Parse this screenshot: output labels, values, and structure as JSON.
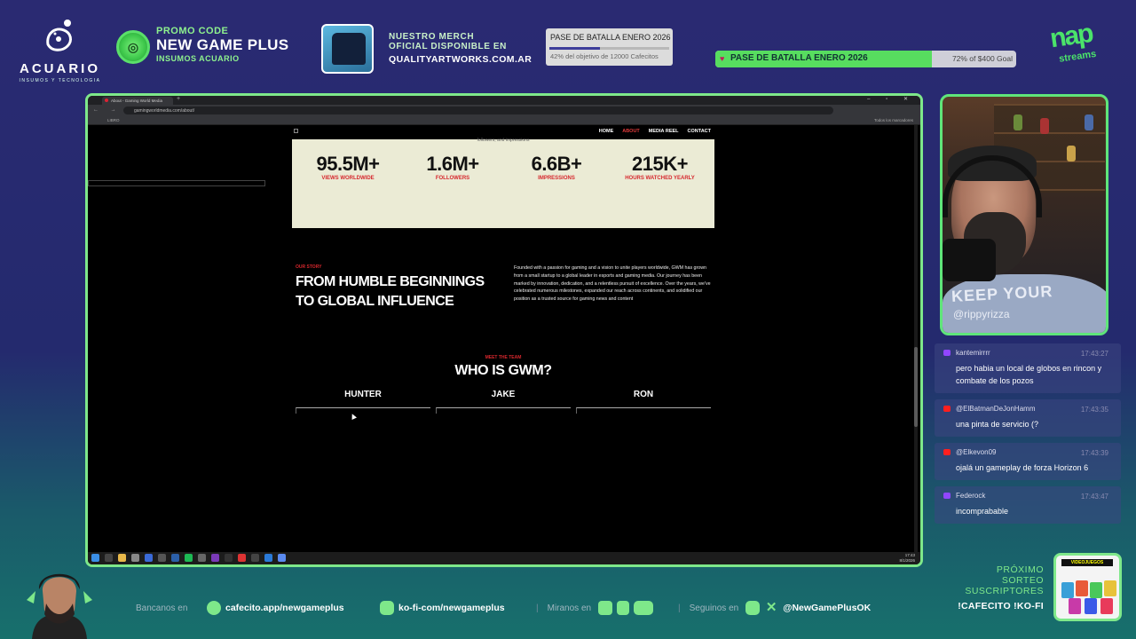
{
  "overlay": {
    "sponsor": {
      "name": "ACUARIO",
      "tagline": "INSUMOS Y TECNOLOGIA"
    },
    "promo": {
      "line1": "PROMO CODE",
      "code": "NEW GAME PLUS",
      "line3": "INSUMOS ACUARIO"
    },
    "merch": {
      "line1": "NUESTRO MERCH",
      "line2": "OFICIAL DISPONIBLE EN",
      "url": "QUALITYARTWORKS.COM.AR"
    },
    "goal_small": {
      "title": "PASE DE BATALLA ENERO 2026",
      "progress": 0.42,
      "status": "42% del objetivo de 12000 Cafecitos"
    },
    "goal_bar": {
      "title": "PASE DE BATALLA ENERO 2026",
      "progress": 0.72,
      "amount": "72% of $400 Goal"
    },
    "channel_logo": {
      "name": "nap",
      "sub": "streams"
    }
  },
  "browser": {
    "tab_title": "About - Gaming World Media",
    "url": "gamingworldmedia.com/about/",
    "bookmark_left": "LIBRO",
    "bookmark_right": "Todos los marcadores",
    "site": {
      "nav": [
        "HOME",
        "ABOUT",
        "MEDIA REEL",
        "CONTACT"
      ],
      "stats_caption": "followers, and impressions",
      "stats": [
        {
          "value": "95.5M+",
          "label": "VIEWS WORLDWIDE"
        },
        {
          "value": "1.6M+",
          "label": "FOLLOWERS"
        },
        {
          "value": "6.6B+",
          "label": "IMPRESSIONS"
        },
        {
          "value": "215K+",
          "label": "HOURS WATCHED YEARLY"
        }
      ],
      "story": {
        "eyebrow": "OUR STORY",
        "title_line1": "FROM HUMBLE BEGINNINGS",
        "title_line2": "TO GLOBAL INFLUENCE",
        "body": "Founded with a passion for gaming and a vision to unite players worldwide, GWM has grown from a small startup to a global leader in esports and gaming media. Our journey has been marked by innovation, dedication, and a relentless pursuit of excellence. Over the years, we've celebrated numerous milestones, expanded our reach across continents, and solidified our position as a trusted source for gaming news and content"
      },
      "team": {
        "eyebrow": "MEET THE TEAM",
        "title": "WHO IS GWM?",
        "members": [
          "HUNTER",
          "JAKE",
          "RON"
        ]
      }
    },
    "clock": {
      "time": "17:43",
      "date": "8/1/2026"
    }
  },
  "webcam": {
    "shirt_text": "KEEP YOUR",
    "handle": "@rippyrizza"
  },
  "chat": [
    {
      "user": "kantemirrrr",
      "platform": "twitch",
      "time": "17:43:27",
      "text": "pero habia un local de globos en rincon y combate de los pozos"
    },
    {
      "user": "@ElBatmanDeJonHamm",
      "platform": "youtube",
      "time": "17:43:35",
      "text": "una pinta de servicio (?"
    },
    {
      "user": "@Elkevon09",
      "platform": "youtube",
      "time": "17:43:39",
      "text": "ojalá un gameplay de forza Horizon 6"
    },
    {
      "user": "Federock",
      "platform": "twitch",
      "time": "17:43:47",
      "text": "incomprabable"
    }
  ],
  "bottom": {
    "bancanos_label": "Bancanos en",
    "cafecito": "cafecito.app/newgameplus",
    "kofi": "ko-fi-com/newgameplus",
    "miranos_label": "Miranos en",
    "seguinos_label": "Seguinos en",
    "social_handle": "@NewGamePlusOK",
    "sorteo": [
      "PRÓXIMO",
      "SORTEO",
      "SUSCRIPTORES"
    ],
    "commands": "!CAFECITO  !KO-FI",
    "prize_header": "VIDEOJUEGOS"
  },
  "colors": {
    "accent_green": "#7ee88a",
    "gwm_red": "#d6272d",
    "stats_bg": "#ebebd5"
  }
}
